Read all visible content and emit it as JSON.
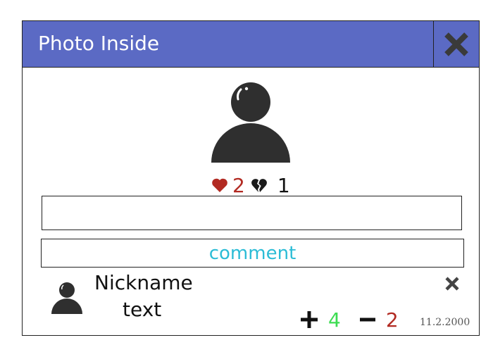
{
  "dialog": {
    "title": "Photo Inside",
    "close_icon": "close-icon"
  },
  "photo": {
    "avatar_icon": "user-icon",
    "likes": "2",
    "dislikes": "1",
    "like_icon": "heart-icon",
    "dislike_icon": "broken-heart-icon"
  },
  "comment_form": {
    "input_value": "",
    "input_placeholder": "",
    "submit_label": "comment"
  },
  "comments": [
    {
      "nickname": "Nickname",
      "text": "text",
      "upvotes": "4",
      "downvotes": "2",
      "date": "11.2.2000"
    }
  ],
  "colors": {
    "titlebar": "#5b6ac4",
    "accent": "#2bbcd6",
    "like": "#b22a22",
    "upvote": "#3ddc52",
    "downvote": "#b22a22"
  }
}
